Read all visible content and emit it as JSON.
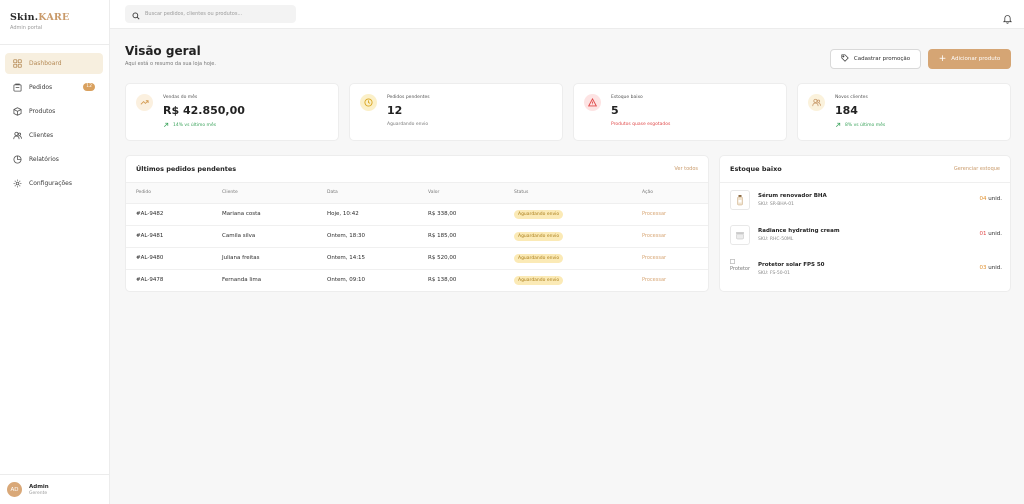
{
  "brand": {
    "name_main": "Skin.",
    "name_accent": "KARE",
    "subtitle": "Admin portal"
  },
  "nav": [
    {
      "label": "Dashboard",
      "icon": "dashboard-icon",
      "active": true
    },
    {
      "label": "Pedidos",
      "icon": "orders-icon",
      "badge": "12"
    },
    {
      "label": "Produtos",
      "icon": "box-icon"
    },
    {
      "label": "Clientes",
      "icon": "users-icon"
    },
    {
      "label": "Relatórios",
      "icon": "chart-icon"
    },
    {
      "label": "Configurações",
      "icon": "gear-icon"
    }
  ],
  "user": {
    "initials": "AD",
    "name": "Admin",
    "role": "Gerente"
  },
  "search": {
    "placeholder": "Buscar pedidos, clientes ou produtos..."
  },
  "header": {
    "title": "Visão geral",
    "subtitle": "Aqui está o resumo da sua loja hoje.",
    "promo_button": "Cadastrar promoção",
    "add_button": "Adicionar produto"
  },
  "stats": [
    {
      "label": "Vendas do mês",
      "value": "R$ 42.850,00",
      "note": "14% vs último mês"
    },
    {
      "label": "Pedidos pendentes",
      "value": "12",
      "note": "Aguardando envio"
    },
    {
      "label": "Estoque baixo",
      "value": "5",
      "note": "Produtos quase esgotados"
    },
    {
      "label": "Novos clientes",
      "value": "184",
      "note": "8% vs último mês"
    }
  ],
  "orders": {
    "title": "Últimos pedidos pendentes",
    "link": "Ver todos",
    "columns": [
      "Pedido",
      "Cliente",
      "Data",
      "Valor",
      "Status",
      "Ação"
    ],
    "rows": [
      {
        "id": "#AL-9482",
        "client": "Mariana costa",
        "date": "Hoje, 10:42",
        "value": "R$ 338,00",
        "status": "Aguardando envio",
        "action": "Processar"
      },
      {
        "id": "#AL-9481",
        "client": "Camila silva",
        "date": "Ontem, 18:30",
        "value": "R$ 185,00",
        "status": "Aguardando envio",
        "action": "Processar"
      },
      {
        "id": "#AL-9480",
        "client": "Juliana freitas",
        "date": "Ontem, 14:15",
        "value": "R$ 520,00",
        "status": "Aguardando envio",
        "action": "Processar"
      },
      {
        "id": "#AL-9478",
        "client": "Fernanda lima",
        "date": "Ontem, 09:10",
        "value": "R$ 138,00",
        "status": "Aguardando envio",
        "action": "Processar"
      }
    ]
  },
  "stock": {
    "title": "Estoque baixo",
    "link": "Gerenciar estoque",
    "items": [
      {
        "name": "Sérum renovador BHA",
        "sku": "SKU: SR-BHA-01",
        "qty": "04",
        "unit": "unid."
      },
      {
        "name": "Radiance hydrating cream",
        "sku": "SKU: RHC-50ML",
        "qty": "01",
        "unit": "unid."
      },
      {
        "name": "Protetor solar FPS 50",
        "sku": "SKU: FS-50-01",
        "qty": "03",
        "unit": "unid.",
        "broken_alt": "Protetor"
      }
    ]
  },
  "colors": {
    "accent": "#d5a574",
    "green": "#3aa35b",
    "red": "#e04848"
  }
}
